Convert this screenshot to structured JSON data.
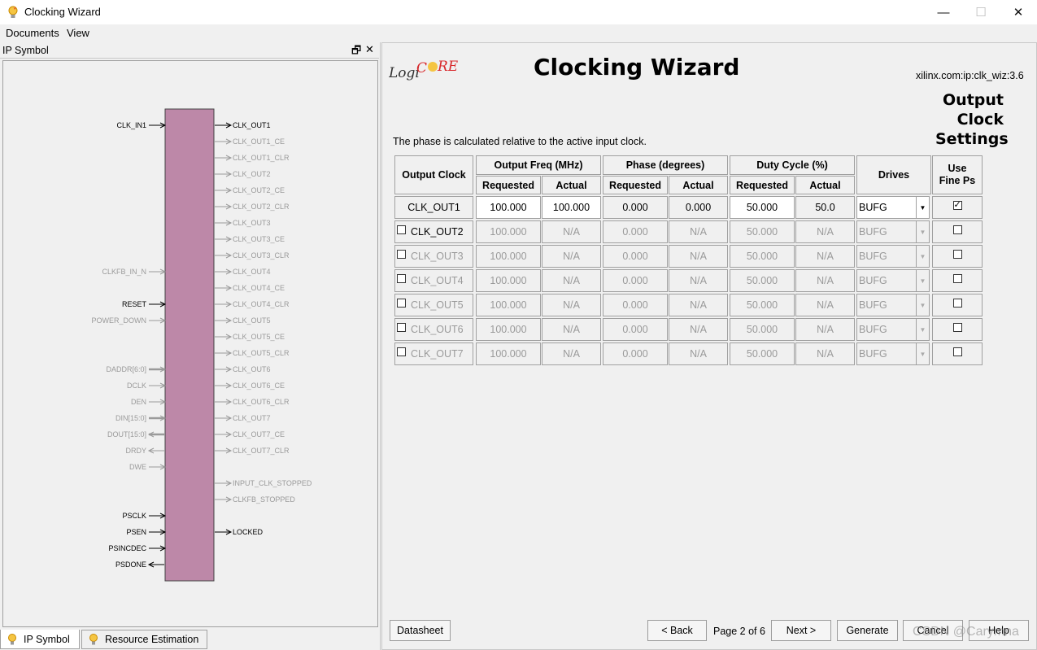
{
  "window": {
    "title": "Clocking Wizard",
    "minimize": "—",
    "maximize": "☐",
    "close": "✕"
  },
  "menu": [
    "Documents",
    "View"
  ],
  "left_panel": {
    "title": "IP Symbol",
    "restore": "🗗",
    "close": "✕",
    "tabs": [
      "IP Symbol",
      "Resource Estimation"
    ],
    "left_pins": [
      {
        "label": "CLK_IN1",
        "active": true,
        "bus": false,
        "dir": "in"
      },
      {
        "label": "CLKFB_IN_N",
        "active": false,
        "bus": false,
        "dir": "in"
      },
      {
        "label": "RESET",
        "active": true,
        "bus": false,
        "dir": "in"
      },
      {
        "label": "POWER_DOWN",
        "active": false,
        "bus": false,
        "dir": "in"
      },
      {
        "label": "DADDR[6:0]",
        "active": false,
        "bus": true,
        "dir": "in"
      },
      {
        "label": "DCLK",
        "active": false,
        "bus": false,
        "dir": "in"
      },
      {
        "label": "DEN",
        "active": false,
        "bus": false,
        "dir": "in"
      },
      {
        "label": "DIN[15:0]",
        "active": false,
        "bus": true,
        "dir": "in"
      },
      {
        "label": "DOUT[15:0]",
        "active": false,
        "bus": true,
        "dir": "out"
      },
      {
        "label": "DRDY",
        "active": false,
        "bus": false,
        "dir": "out"
      },
      {
        "label": "DWE",
        "active": false,
        "bus": false,
        "dir": "in"
      },
      {
        "label": "PSCLK",
        "active": true,
        "bus": false,
        "dir": "in"
      },
      {
        "label": "PSEN",
        "active": true,
        "bus": false,
        "dir": "in"
      },
      {
        "label": "PSINCDEC",
        "active": true,
        "bus": false,
        "dir": "in"
      },
      {
        "label": "PSDONE",
        "active": true,
        "bus": false,
        "dir": "out"
      }
    ],
    "right_pins": [
      {
        "label": "CLK_OUT1",
        "active": true
      },
      {
        "label": "CLK_OUT1_CE",
        "active": false
      },
      {
        "label": "CLK_OUT1_CLR",
        "active": false
      },
      {
        "label": "CLK_OUT2",
        "active": false
      },
      {
        "label": "CLK_OUT2_CE",
        "active": false
      },
      {
        "label": "CLK_OUT2_CLR",
        "active": false
      },
      {
        "label": "CLK_OUT3",
        "active": false
      },
      {
        "label": "CLK_OUT3_CE",
        "active": false
      },
      {
        "label": "CLK_OUT3_CLR",
        "active": false
      },
      {
        "label": "CLK_OUT4",
        "active": false
      },
      {
        "label": "CLK_OUT4_CE",
        "active": false
      },
      {
        "label": "CLK_OUT4_CLR",
        "active": false
      },
      {
        "label": "CLK_OUT5",
        "active": false
      },
      {
        "label": "CLK_OUT5_CE",
        "active": false
      },
      {
        "label": "CLK_OUT5_CLR",
        "active": false
      },
      {
        "label": "CLK_OUT6",
        "active": false
      },
      {
        "label": "CLK_OUT6_CE",
        "active": false
      },
      {
        "label": "CLK_OUT6_CLR",
        "active": false
      },
      {
        "label": "CLK_OUT7",
        "active": false
      },
      {
        "label": "CLK_OUT7_CE",
        "active": false
      },
      {
        "label": "CLK_OUT7_CLR",
        "active": false
      },
      {
        "label": "INPUT_CLK_STOPPED",
        "active": false
      },
      {
        "label": "CLKFB_STOPPED",
        "active": false
      },
      {
        "label": "LOCKED",
        "active": true
      }
    ],
    "block_color": "#bd88a8"
  },
  "right_panel": {
    "logo_text": "LogiCORE",
    "title": "Clocking Wizard",
    "ip_id": "xilinx.com:ip:clk_wiz:3.6",
    "section_title": "Output Clock Settings",
    "phase_note": "The phase is calculated relative to the active input clock.",
    "table": {
      "headers": {
        "output_clock": "Output Clock",
        "output_freq": "Output Freq (MHz)",
        "phase": "Phase (degrees)",
        "duty": "Duty Cycle (%)",
        "drives": "Drives",
        "fine_ps": "Use Fine Ps",
        "requested": "Requested",
        "actual": "Actual"
      },
      "rows": [
        {
          "name": "CLK_OUT1",
          "enabled": true,
          "has_checkbox": false,
          "freq_req": "100.000",
          "freq_act": "100.000",
          "phase_req": "0.000",
          "phase_act": "0.000",
          "duty_req": "50.000",
          "duty_act": "50.0",
          "drives": "BUFG",
          "fine_ps": true
        },
        {
          "name": "CLK_OUT2",
          "enabled": false,
          "has_checkbox": true,
          "freq_req": "100.000",
          "freq_act": "N/A",
          "phase_req": "0.000",
          "phase_act": "N/A",
          "duty_req": "50.000",
          "duty_act": "N/A",
          "drives": "BUFG",
          "fine_ps": false
        },
        {
          "name": "CLK_OUT3",
          "enabled": false,
          "has_checkbox": true,
          "freq_req": "100.000",
          "freq_act": "N/A",
          "phase_req": "0.000",
          "phase_act": "N/A",
          "duty_req": "50.000",
          "duty_act": "N/A",
          "drives": "BUFG",
          "fine_ps": false
        },
        {
          "name": "CLK_OUT4",
          "enabled": false,
          "has_checkbox": true,
          "freq_req": "100.000",
          "freq_act": "N/A",
          "phase_req": "0.000",
          "phase_act": "N/A",
          "duty_req": "50.000",
          "duty_act": "N/A",
          "drives": "BUFG",
          "fine_ps": false
        },
        {
          "name": "CLK_OUT5",
          "enabled": false,
          "has_checkbox": true,
          "freq_req": "100.000",
          "freq_act": "N/A",
          "phase_req": "0.000",
          "phase_act": "N/A",
          "duty_req": "50.000",
          "duty_act": "N/A",
          "drives": "BUFG",
          "fine_ps": false
        },
        {
          "name": "CLK_OUT6",
          "enabled": false,
          "has_checkbox": true,
          "freq_req": "100.000",
          "freq_act": "N/A",
          "phase_req": "0.000",
          "phase_act": "N/A",
          "duty_req": "50.000",
          "duty_act": "N/A",
          "drives": "BUFG",
          "fine_ps": false
        },
        {
          "name": "CLK_OUT7",
          "enabled": false,
          "has_checkbox": true,
          "freq_req": "100.000",
          "freq_act": "N/A",
          "phase_req": "0.000",
          "phase_act": "N/A",
          "duty_req": "50.000",
          "duty_act": "N/A",
          "drives": "BUFG",
          "fine_ps": false
        }
      ]
    },
    "buttons": {
      "datasheet": "Datasheet",
      "back": "< Back",
      "page_info": "Page 2 of 6",
      "next": "Next >",
      "generate": "Generate",
      "cancel": "Cancel",
      "help": "Help"
    }
  },
  "watermark": "CSDN @Carymna"
}
